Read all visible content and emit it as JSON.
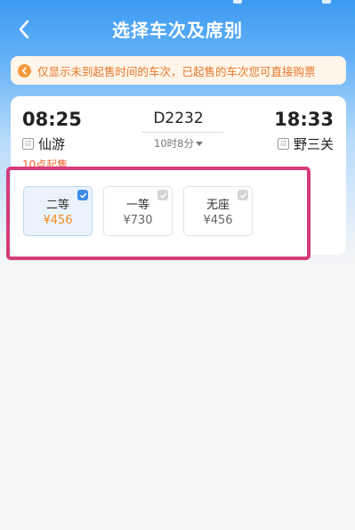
{
  "header": {
    "title": "选择车次及席别"
  },
  "notice": {
    "text": "仅显示未到起售时间的车次，已起售的车次您可直接购票"
  },
  "train": {
    "departure_time": "08:25",
    "arrival_time": "18:33",
    "number": "D2232",
    "duration": "10时8分",
    "departure_station": "仙游",
    "arrival_station": "野三关",
    "pass_badge": "过",
    "sale_note": "10点起售"
  },
  "seats": [
    {
      "name": "二等",
      "price": "¥456",
      "selected": true
    },
    {
      "name": "一等",
      "price": "¥730",
      "selected": false
    },
    {
      "name": "无座",
      "price": "¥456",
      "selected": false
    }
  ],
  "colors": {
    "header_blue": "#3d9bf3",
    "notice_orange": "#e5772b",
    "price_orange": "#f28a1e",
    "check_blue": "#3b8ae8",
    "highlight_pink": "#d53c7a"
  },
  "icons": {
    "back": "back-arrow-icon",
    "notice": "notice-arrow-icon",
    "check": "checkmark-icon",
    "duration": "caret-down-icon"
  }
}
